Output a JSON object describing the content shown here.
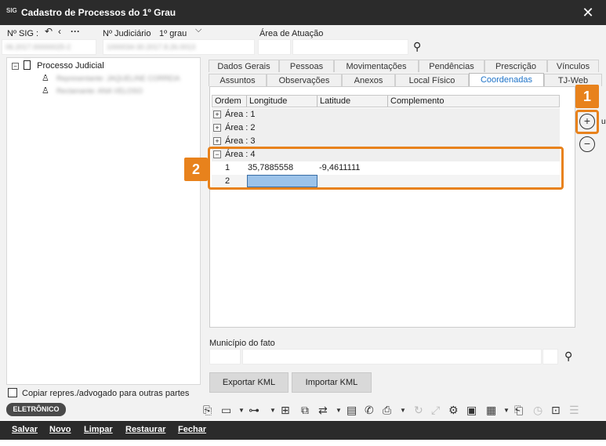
{
  "window": {
    "app_icon": "SIG",
    "title": "Cadastro de Processos do 1º Grau",
    "close_glyph": "✕"
  },
  "header": {
    "sig_label": "Nº SIG :",
    "sig_value": "06.2017.00000025-2",
    "judiciario_label": "Nº Judiciário",
    "grau_label": "1º grau",
    "judiciario_value": "1000034-30.2017.8.26.0013",
    "area_label": "Área de Atuação"
  },
  "tree": {
    "root_label": "Processo Judicial",
    "child1": "Representante: JAQUELINE CORREIA",
    "child2": "Reclamante: ANA VELOSO"
  },
  "tabs_row1": [
    "Dados Gerais",
    "Pessoas",
    "Movimentações",
    "Pendências",
    "Prescrição",
    "Vínculos"
  ],
  "tabs_row2": [
    "Assuntos",
    "Observações",
    "Anexos",
    "Local Físico",
    "Coordenadas",
    "TJ-Web"
  ],
  "grid": {
    "columns": [
      "Ordem",
      "Longitude",
      "Latitude",
      "Complemento"
    ],
    "areas": [
      {
        "label": "Área : 1",
        "expander": "+"
      },
      {
        "label": "Área : 2",
        "expander": "+"
      },
      {
        "label": "Área : 3",
        "expander": "+"
      },
      {
        "label": "Área : 4",
        "expander": "−"
      }
    ],
    "rows": [
      {
        "ordem": "1",
        "longitude": "35,7885558",
        "latitude": "-9,4611111",
        "complemento": ""
      },
      {
        "ordem": "2",
        "longitude": "",
        "latitude": "",
        "complemento": ""
      }
    ]
  },
  "annotations": {
    "badge1": "1",
    "badge2": "2",
    "side_label": "u"
  },
  "municipio_label": "Município do fato",
  "buttons": {
    "export_kml": "Exportar KML",
    "import_kml": "Importar KML"
  },
  "copy_checkbox_label": "Copiar repres./advogado para outras partes",
  "chip": "ELETRÔNICO",
  "actions": [
    "Salvar",
    "Novo",
    "Limpar",
    "Restaurar",
    "Fechar"
  ],
  "colors": {
    "accent": "#e8821c",
    "tab_active": "#1e73c8",
    "selection": "#9cc3ea"
  }
}
